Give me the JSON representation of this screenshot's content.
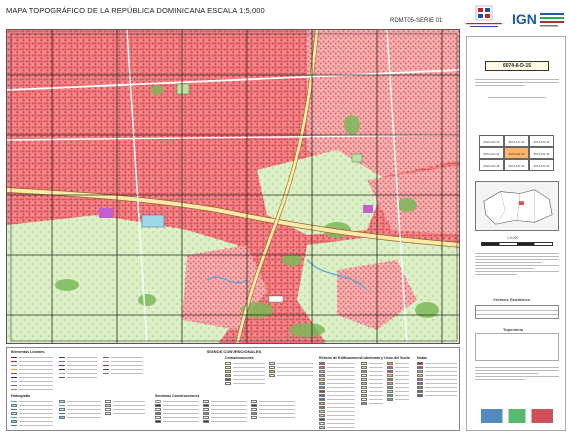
{
  "header": {
    "title": "MAPA TOPOGRÁFICO DE LA REPÚBLICA DOMINICANA ESCALA 1:5,000",
    "serie": "RDMT05-SERIE 01",
    "ign_logo": "IGN"
  },
  "sidebar": {
    "sheet_code": "6074-II-D-15",
    "scale_text": "1:5,000",
    "vertices_title": "Vértices Geodésico",
    "toponimia_title": "Toponimia",
    "index_cells": [
      [
        "6074-II-D-10",
        "6074-II-D-11",
        "6074-II-D-12"
      ],
      [
        "6074-II-D-14",
        "6074-II-D-15",
        "6074-II-D-16"
      ],
      [
        "6074-II-D-18",
        "6074-II-D-19",
        "6074-II-D-20"
      ]
    ]
  },
  "legend": {
    "title": "SIGNOS CONVENCIONALES",
    "sections": {
      "elementos_lineales": "Elementos Lineales",
      "hidrografia": "Hidrografía",
      "simbolos_construcciones": "Símbolos Construcciones",
      "comunicaciones": "Comunicaciones",
      "relleno_edificaciones": "Relleno de Edificaciones",
      "coberturas_usos_suelo": "Coberturas y Usos del Suelo",
      "notas": "Notas"
    }
  },
  "colors": {
    "urban_red": "#e8484f",
    "urban_pink": "#f6b4b4",
    "vegetation_green": "#d7ecc0",
    "dense_green": "#7bb85a",
    "grid_black": "#222222",
    "water_blue": "#4aa8d8",
    "highway_yellow": "#ffe9a8"
  }
}
